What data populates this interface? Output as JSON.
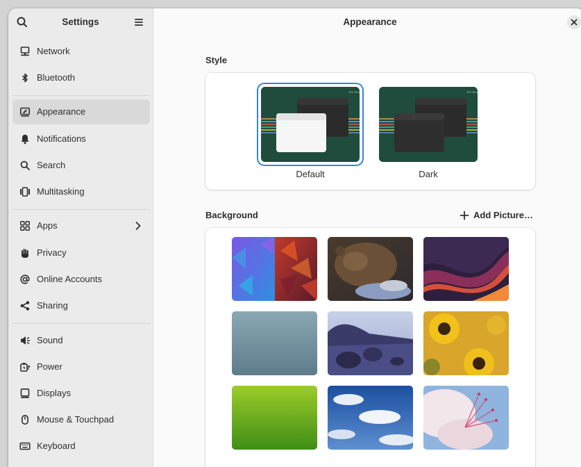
{
  "sidebar": {
    "title": "Settings",
    "items": [
      {
        "label": "Network",
        "icon": "network-icon"
      },
      {
        "label": "Bluetooth",
        "icon": "bluetooth-icon"
      },
      {
        "label": "Appearance",
        "icon": "appearance-icon",
        "selected": true
      },
      {
        "label": "Notifications",
        "icon": "bell-icon"
      },
      {
        "label": "Search",
        "icon": "search-icon"
      },
      {
        "label": "Multitasking",
        "icon": "multitasking-icon"
      },
      {
        "label": "Apps",
        "icon": "apps-grid-icon"
      },
      {
        "label": "Privacy",
        "icon": "hand-icon"
      },
      {
        "label": "Online Accounts",
        "icon": "at-sign-icon"
      },
      {
        "label": "Sharing",
        "icon": "share-icon"
      },
      {
        "label": "Sound",
        "icon": "speaker-icon"
      },
      {
        "label": "Power",
        "icon": "power-icon"
      },
      {
        "label": "Displays",
        "icon": "display-icon"
      },
      {
        "label": "Mouse & Touchpad",
        "icon": "mouse-icon"
      },
      {
        "label": "Keyboard",
        "icon": "keyboard-icon"
      }
    ]
  },
  "main": {
    "title": "Appearance",
    "style_section": {
      "title": "Style",
      "options": [
        {
          "label": "Default",
          "selected": true
        },
        {
          "label": "Dark",
          "selected": false
        }
      ]
    },
    "background_section": {
      "title": "Background",
      "add_picture_label": "Add Picture…",
      "wallpapers": [
        {
          "name": "blue-red-geometric-wallpaper"
        },
        {
          "name": "bear-wallpaper"
        },
        {
          "name": "purple-orange-waves-wallpaper"
        },
        {
          "name": "gray-blue-texture-wallpaper"
        },
        {
          "name": "beach-rocks-wallpaper"
        },
        {
          "name": "sunflowers-wallpaper"
        },
        {
          "name": "green-rays-wallpaper"
        },
        {
          "name": "sky-clouds-wallpaper"
        },
        {
          "name": "pink-blossom-wallpaper"
        }
      ]
    }
  },
  "colors": {
    "accent": "#3584e4",
    "sidebar_bg": "#ebebeb",
    "selected_bg": "#d9d9d9",
    "content_bg": "#fafafa"
  }
}
